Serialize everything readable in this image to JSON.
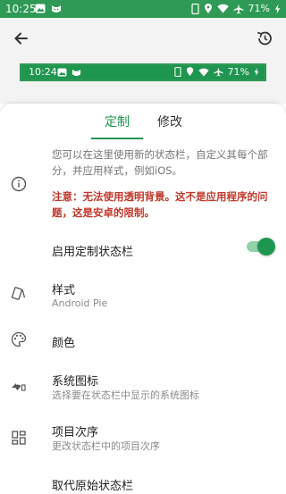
{
  "status_bar": {
    "time": "10:25",
    "battery": "71%"
  },
  "preview_bar": {
    "time": "10:24",
    "battery": "71%"
  },
  "tabs": [
    {
      "label": "定制",
      "active": true
    },
    {
      "label": "修改",
      "active": false
    }
  ],
  "info": {
    "description": "您可以在这里使用新的状态栏，自定义其每个部分，并应用样式，例如iOS。",
    "warning": "注意：无法使用透明背景。这不是应用程序的问题，这是安卓的限制。"
  },
  "settings": [
    {
      "title": "启用定制状态栏"
    },
    {
      "title": "样式",
      "subtitle": "Android Pie"
    },
    {
      "title": "颜色"
    },
    {
      "title": "系统图标",
      "subtitle": "选择要在状态栏中显示的系统图标"
    },
    {
      "title": "项目次序",
      "subtitle": "更改状态栏中的项目次序"
    },
    {
      "title": "取代原始状态栏"
    }
  ],
  "colors": {
    "accent": "#1f9650",
    "warning": "#c0392b",
    "statusbar": "#2e9a55"
  }
}
